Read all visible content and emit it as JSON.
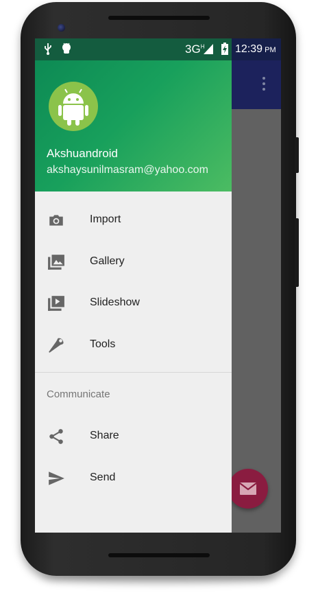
{
  "status_bar": {
    "network": "3G",
    "network_badge": "H",
    "time": "12:39",
    "ampm": "PM",
    "icons": [
      "usb-icon",
      "android-debug-icon",
      "signal-icon",
      "battery-charging-icon"
    ]
  },
  "drawer_header": {
    "user_name": "Akshuandroid",
    "user_email": "akshaysunilmasram@yahoo.com",
    "avatar_icon": "android-robot-icon"
  },
  "menu": {
    "items": [
      {
        "label": "Import",
        "icon": "camera-icon"
      },
      {
        "label": "Gallery",
        "icon": "image-icon"
      },
      {
        "label": "Slideshow",
        "icon": "slideshow-icon"
      },
      {
        "label": "Tools",
        "icon": "wrench-icon"
      }
    ],
    "section_title": "Communicate",
    "section_items": [
      {
        "label": "Share",
        "icon": "share-icon"
      },
      {
        "label": "Send",
        "icon": "send-icon"
      }
    ]
  },
  "fab": {
    "icon": "email-icon"
  },
  "colors": {
    "header_green": "#18a05c",
    "app_bar": "#1c225c",
    "fab_accent": "#8a1c40",
    "drawer_bg": "#efefef"
  }
}
